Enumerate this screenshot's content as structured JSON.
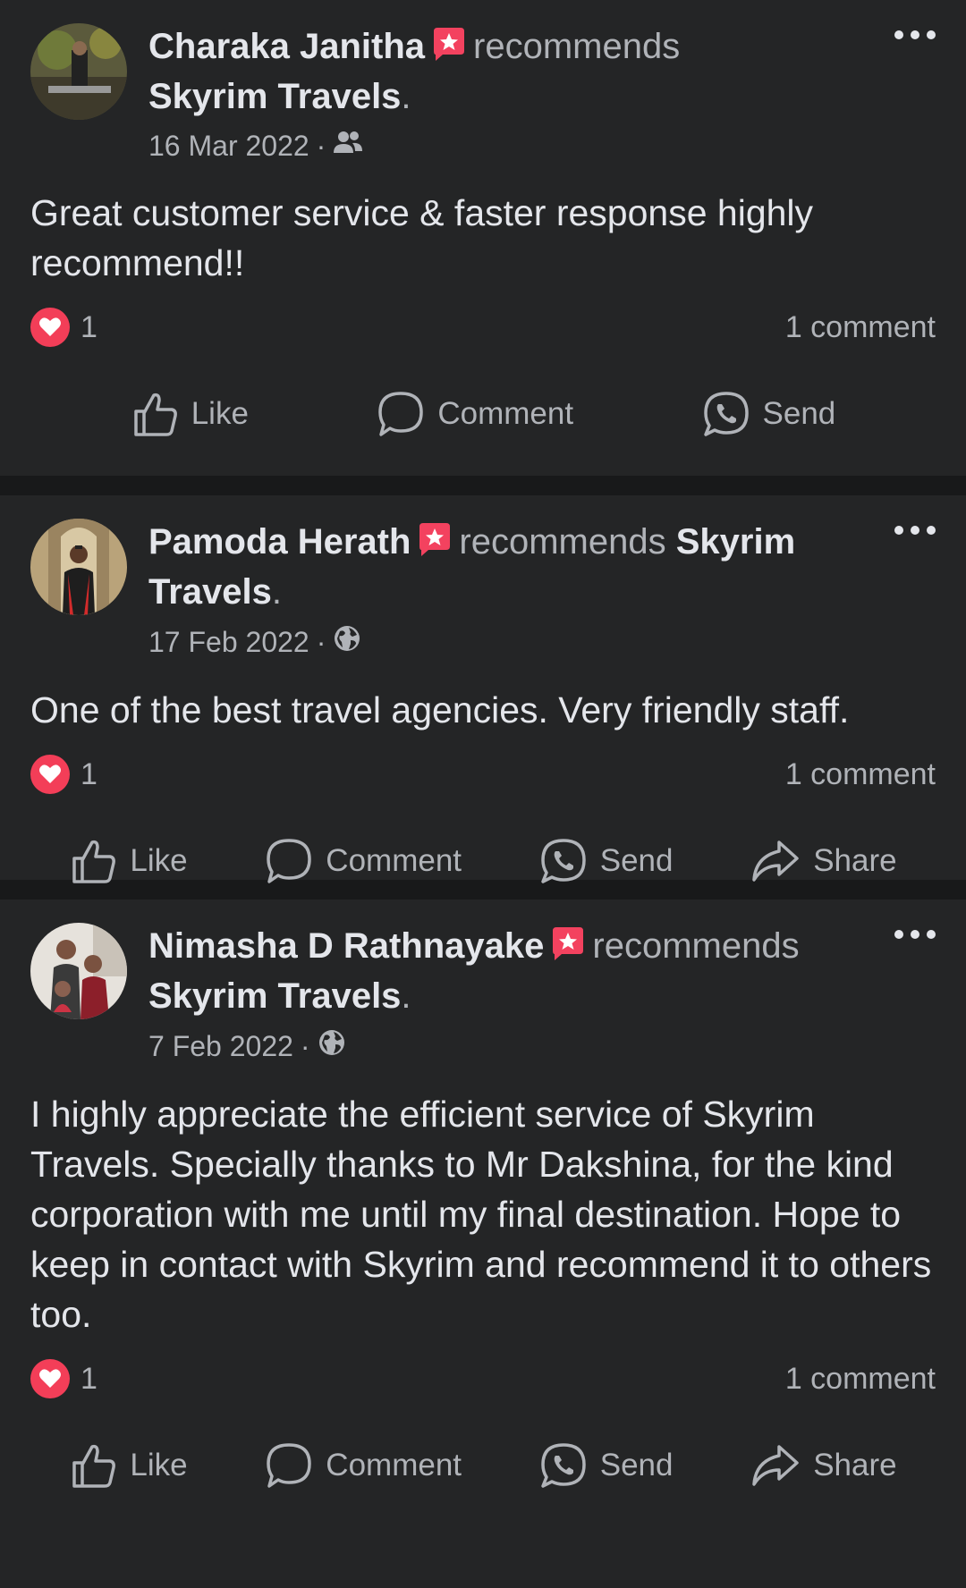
{
  "recommends_word": "recommends",
  "posts": [
    {
      "author": "Charaka Janitha",
      "page": "Skyrim Travels",
      "period": ".",
      "date": "16 Mar 2022",
      "separator": "·",
      "audience_icon": "friends-icon",
      "text": "Great customer service & faster response highly recommend!!",
      "reaction_count": "1",
      "comments": "1 comment",
      "actions": [
        "Like",
        "Comment",
        "Send"
      ]
    },
    {
      "author": "Pamoda Herath",
      "page": "Skyrim Travels",
      "period": ".",
      "date": "17 Feb 2022",
      "separator": "·",
      "audience_icon": "globe-icon",
      "text": "One of the best travel agencies. Very friendly staff.",
      "reaction_count": "1",
      "comments": "1 comment",
      "actions": [
        "Like",
        "Comment",
        "Send",
        "Share"
      ]
    },
    {
      "author": "Nimasha D Rathnayake",
      "page": "Skyrim Travels",
      "period": ".",
      "date": "7 Feb 2022",
      "separator": "·",
      "audience_icon": "globe-icon",
      "text": "I highly appreciate the efficient service of Skyrim Travels. Specially thanks to Mr Dakshina, for the kind corporation with me until my final destination. Hope to keep in contact with Skyrim and recommend it to others too.",
      "reaction_count": "1",
      "comments": "1 comment",
      "actions": [
        "Like",
        "Comment",
        "Send",
        "Share"
      ]
    }
  ],
  "colors": {
    "background": "#18191a",
    "card": "#242526",
    "primary_text": "#e4e6eb",
    "secondary_text": "#b0b3b8",
    "heart": "#f33e58",
    "recommend_badge": "#f3425f"
  }
}
